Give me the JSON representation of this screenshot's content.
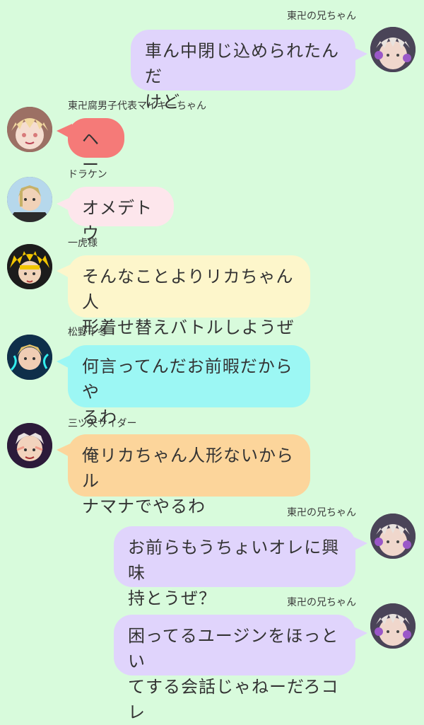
{
  "colors": {
    "background": "#d8fbdc",
    "purple": "#e0d4fc",
    "red": "#f57a78",
    "pink": "#fde6ec",
    "yellow": "#fdf6cb",
    "cyan": "#9cf7f4",
    "orange": "#fcd59b"
  },
  "messages": [
    {
      "side": "right",
      "sender": "東卍の兄ちゃん",
      "text": "車ん中閉じ込められたんだ\nけど",
      "color": "purple",
      "avatar_icon": "mikey-avatar-icon"
    },
    {
      "side": "left",
      "sender": "東卍腐男子代表マイキーちゃん",
      "text": "ヘー",
      "color": "red",
      "avatar_icon": "mikey-avatar-icon"
    },
    {
      "side": "left",
      "sender": "ドラケン",
      "text": "オメデトウ",
      "color": "pink",
      "avatar_icon": "draken-avatar-icon"
    },
    {
      "side": "left",
      "sender": "一虎様",
      "text": "そんなことよりリカちゃん人\n形着せ替えバトルしようぜ",
      "color": "yellow",
      "avatar_icon": "kazutora-avatar-icon"
    },
    {
      "side": "left",
      "sender": "松野千冬",
      "text": "何言ってんだお前暇だからや\nるわ",
      "color": "cyan",
      "avatar_icon": "chifuyu-avatar-icon"
    },
    {
      "side": "left",
      "sender": "三ツ矢サイダー",
      "text": "俺リカちゃん人形ないからル\nナマナでやるわ",
      "color": "orange",
      "avatar_icon": "mitsuya-avatar-icon"
    },
    {
      "side": "right",
      "sender": "東卍の兄ちゃん",
      "text": "お前らもうちょいオレに興味\n持とうぜ？",
      "color": "purple",
      "avatar_icon": "mikey-avatar-icon"
    },
    {
      "side": "right",
      "sender": "東卍の兄ちゃん",
      "text": "困ってるユージンをほっとい\nてする会話じゃねーだろコレ",
      "color": "purple",
      "avatar_icon": "mikey-avatar-icon"
    }
  ]
}
